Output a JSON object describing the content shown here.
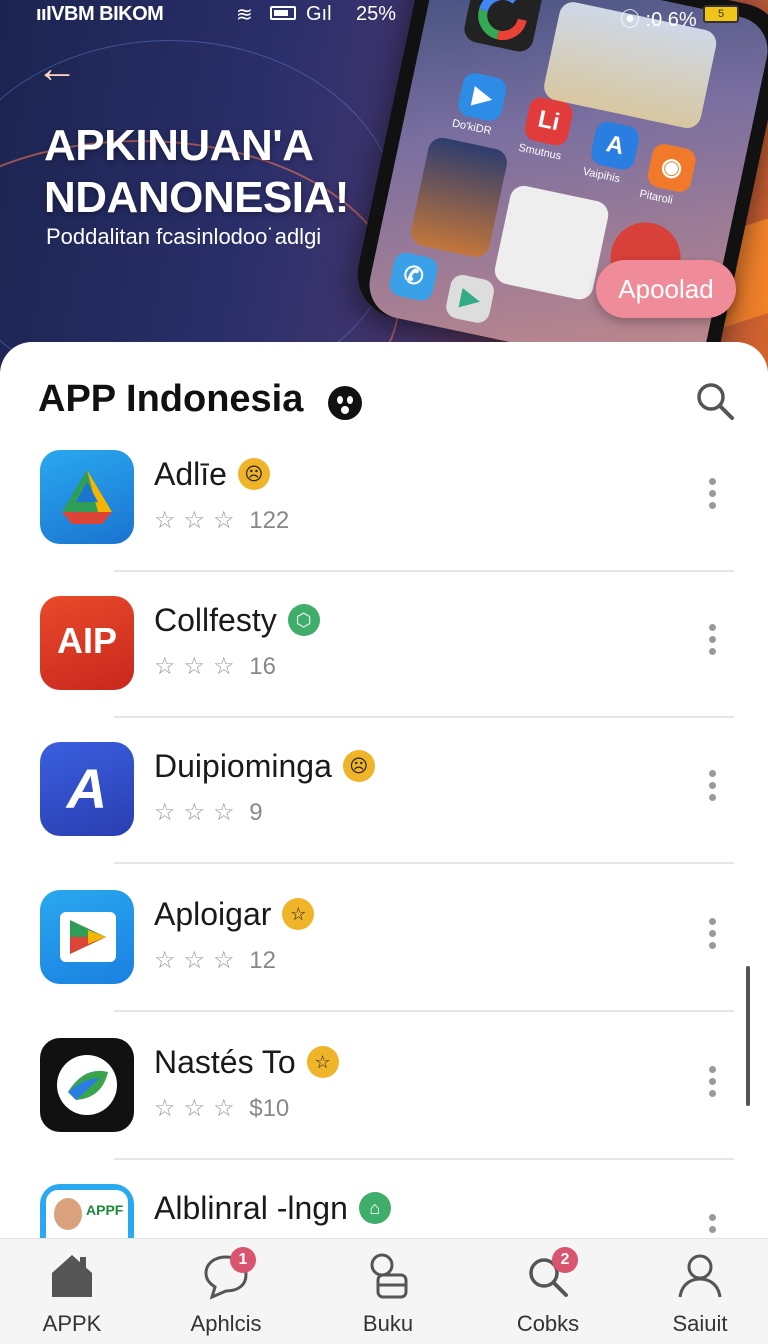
{
  "status_bar": {
    "carrier": "ııIVBM BIKOM",
    "signal": "Gıl",
    "battery_pct": "25%",
    "right_status": "⦿ :0 6%",
    "battery2": "5"
  },
  "hero": {
    "title": "APKINUAN'A NDANONESIA!",
    "subtitle": "Poddalitan fcasinlodoo˙adlgi",
    "cta_label": "Apoolad",
    "phone_labels": [
      "Do'kiDR",
      "Smutnus",
      "Vaipihis",
      "Pitaroli"
    ]
  },
  "list": {
    "title": "APP Indonesia",
    "apps": [
      {
        "name": "Adlīe",
        "stars": "☆☆☆",
        "count": "122",
        "badge_color": "#f0b429",
        "badge_symbol": "☹"
      },
      {
        "name": "Collfesty",
        "stars": "☆☆☆",
        "count": "16",
        "badge_color": "#3fae6a",
        "badge_symbol": "⬡"
      },
      {
        "name": "Duipiominga",
        "stars": "☆☆☆",
        "count": "9",
        "badge_color": "#f0b429",
        "badge_symbol": "☹"
      },
      {
        "name": "Aploigar",
        "stars": "☆☆☆",
        "count": "12",
        "badge_color": "#f0b429",
        "badge_symbol": "☆"
      },
      {
        "name": "Nastés To",
        "stars": "☆☆☆",
        "count": "$10",
        "badge_color": "#f0b429",
        "badge_symbol": "☆"
      },
      {
        "name": "Alblinral -lngn",
        "stars": "",
        "count": "",
        "badge_color": "#3fae6a",
        "badge_symbol": "⌂"
      }
    ],
    "icon_texts": {
      "collfesty": "AIP",
      "duipiominga": "A",
      "alblinral": "APPF"
    }
  },
  "bottom_nav": {
    "items": [
      {
        "label": "APPK",
        "icon": "home-icon"
      },
      {
        "label": "Aphlcis",
        "icon": "chat-bubble-icon",
        "badge": "1"
      },
      {
        "label": "Buku",
        "icon": "bag-icon"
      },
      {
        "label": "Cobks",
        "icon": "search-icon",
        "badge": "2"
      },
      {
        "label": "Saiuit",
        "icon": "profile-icon"
      }
    ]
  },
  "colors": {
    "accent_pink": "#f08c9a",
    "badge_red": "#d9546e"
  }
}
